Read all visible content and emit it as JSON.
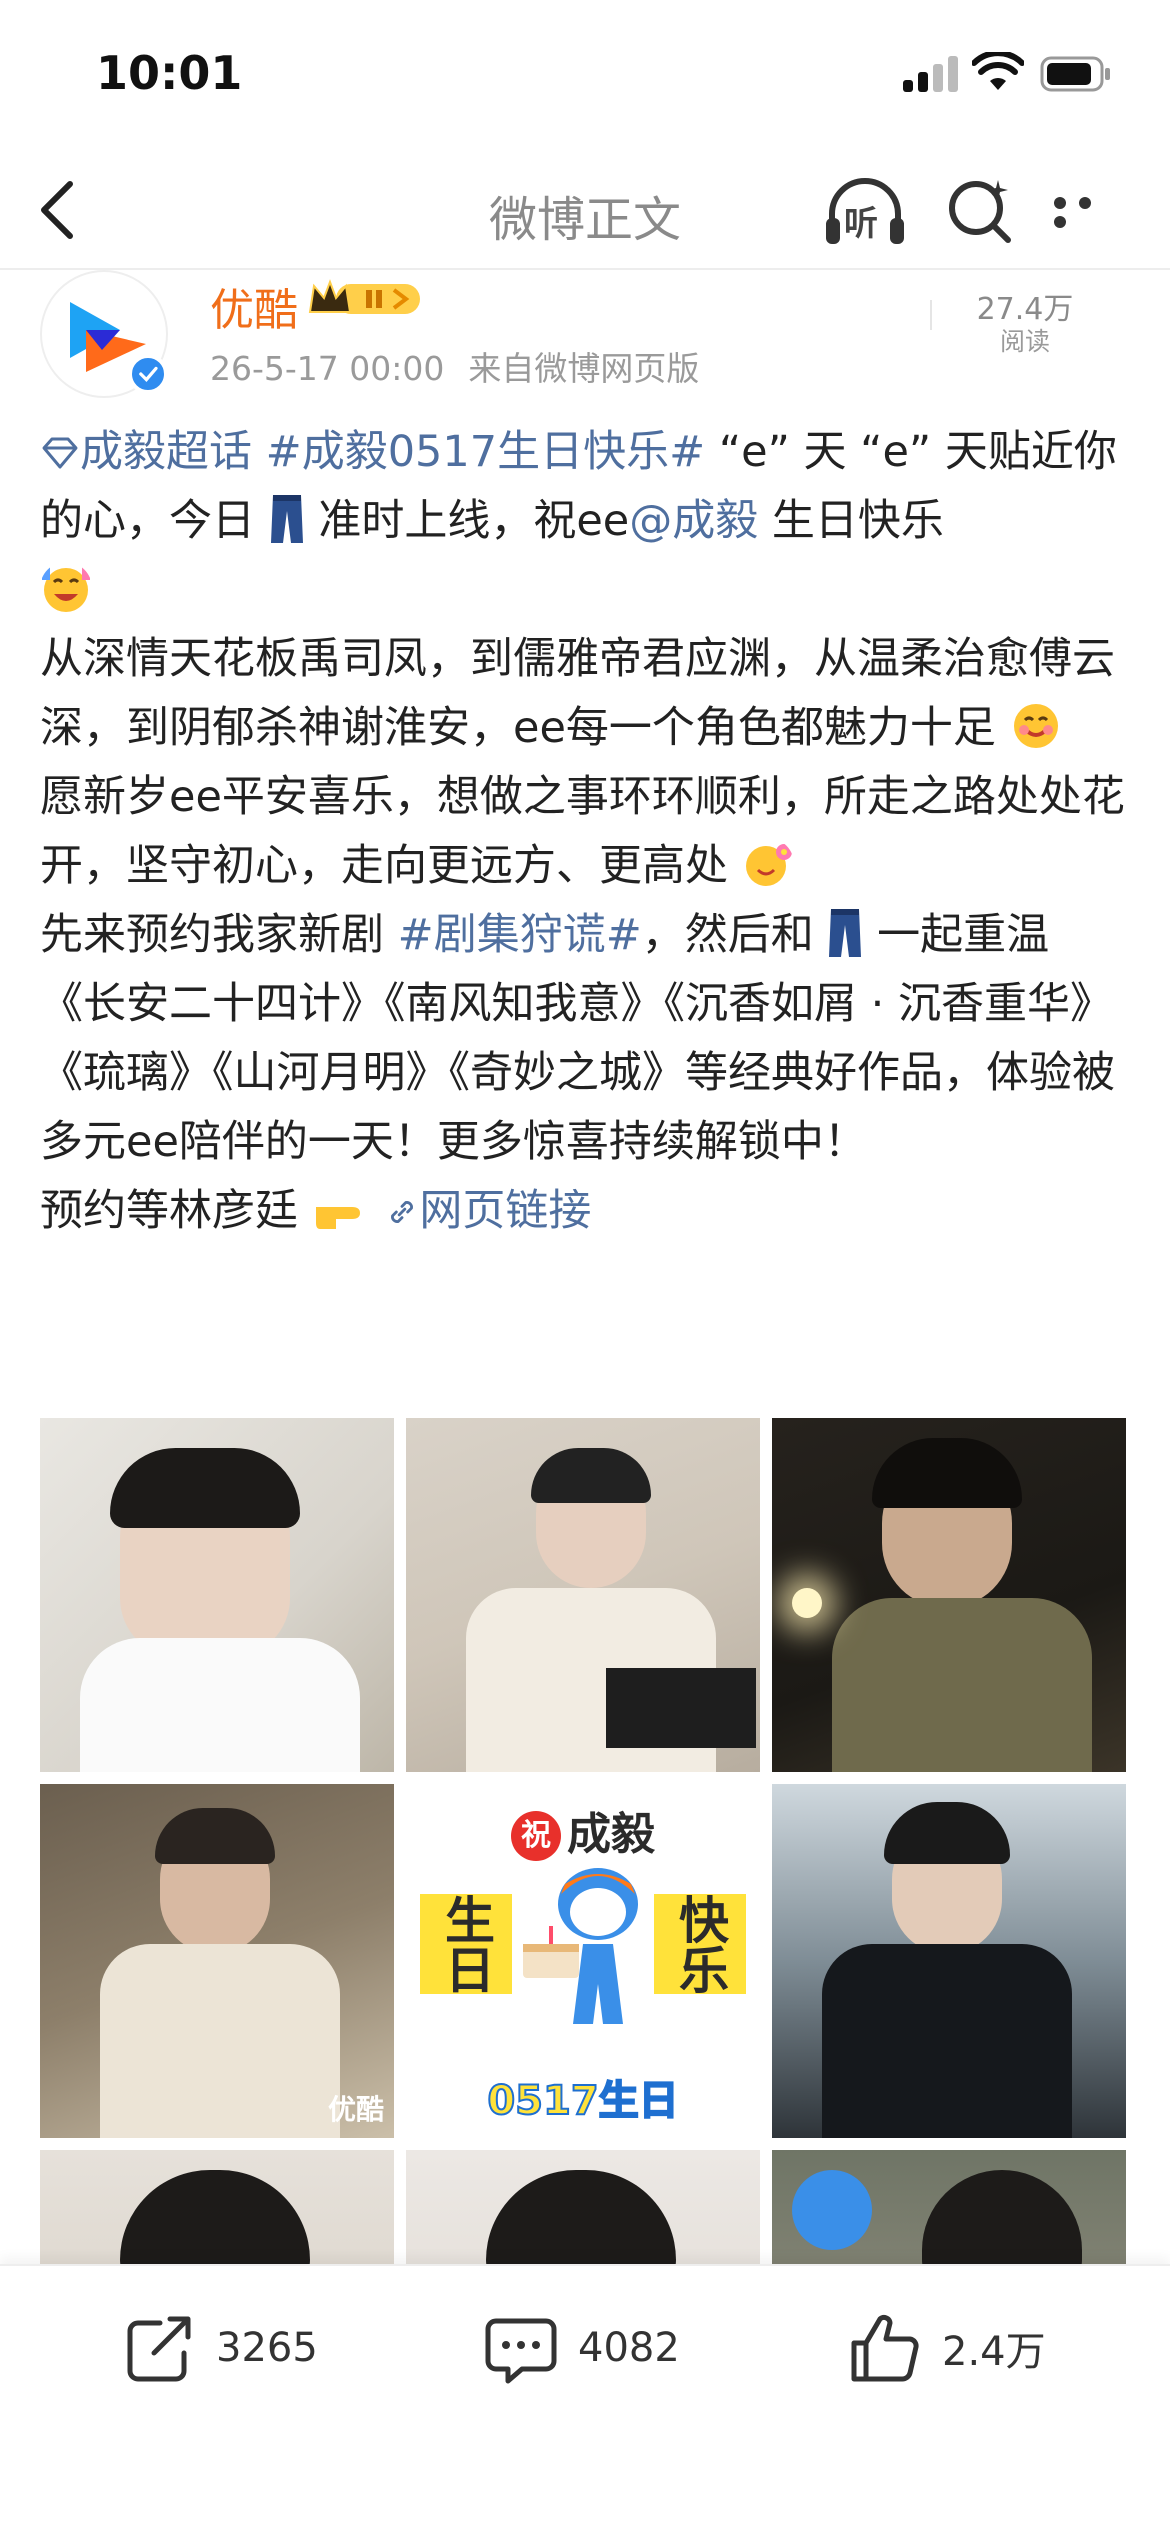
{
  "status_bar": {
    "time": "10:01"
  },
  "nav": {
    "title": "微博正文",
    "listen_label": "听"
  },
  "post": {
    "author": "优酷",
    "timestamp": "26-5-17 00:00",
    "source": "来自微博网页版",
    "reads_count": "27.4万",
    "reads_label": "阅读",
    "text": {
      "super_topic": "成毅超话",
      "hashtag1": "#成毅0517生日快乐#",
      "line1_rest": " “e” 天 “e” 天贴近你的心，今日",
      "line1_mid": "准时上线，祝ee",
      "mention": "@成毅",
      "line1_end": " 生日快乐",
      "para2": "从深情天花板禹司凤，到儒雅帝君应渊，从温柔治愈傅云深，到阴郁杀神谢淮安，ee每一个角色都魅力十足",
      "para3": "愿新岁ee平安喜乐，想做之事环环顺利，所走之路处处花开，坚守初心，走向更远方、更高处",
      "para4_start": "先来预约我家新剧 ",
      "hashtag2": "#剧集狩谎#",
      "para4_mid": "，然后和",
      "para4_end": "一起重温《长安二十四计》《南风知我意》《沉香如屑 · 沉香重华》《琉璃》《山河月明》《奇妙之城》等经典好作品，体验被多元ee陪伴的一天！更多惊喜持续解锁中！",
      "para5": "预约等林彦廷",
      "link_label": "网页链接"
    },
    "images": {
      "birthday_card": {
        "zhu": "祝",
        "name": "成毅",
        "left_chars": "生日",
        "right_chars": "快乐",
        "date_text": "0517生日"
      },
      "watermark": "优酷"
    }
  },
  "actions": {
    "reposts": "3265",
    "comments": "4082",
    "likes": "2.4万"
  },
  "colors": {
    "link": "#4f6f9f",
    "author": "#f06e1a",
    "verify": "#2f8cf0"
  }
}
